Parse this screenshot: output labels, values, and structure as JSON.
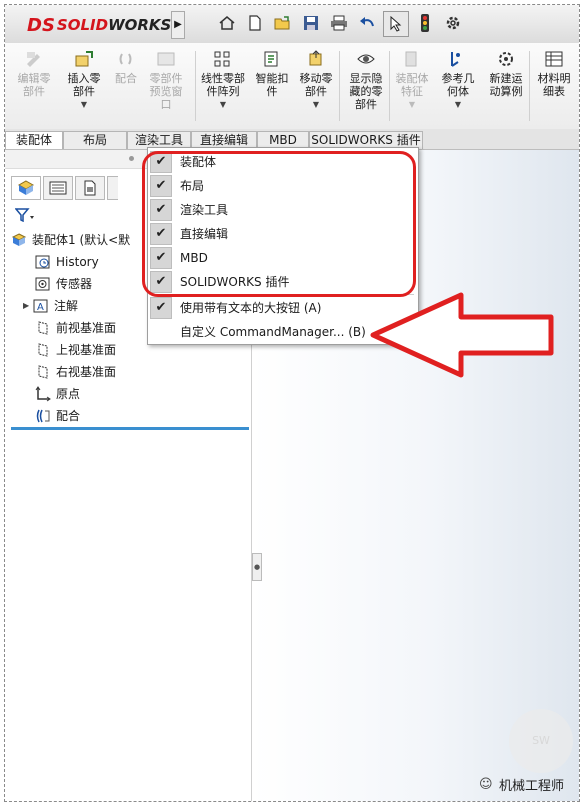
{
  "app": {
    "brand_ds": "DS",
    "brand_name": "SOLID",
    "brand_name2": "WORKS"
  },
  "quick_access": [
    {
      "name": "home-icon",
      "glyph": "⌂"
    },
    {
      "name": "new-file-icon",
      "glyph": "▢"
    },
    {
      "name": "open-icon",
      "glyph": "📂"
    },
    {
      "name": "save-icon",
      "glyph": "💾"
    },
    {
      "name": "print-icon",
      "glyph": "⎙"
    },
    {
      "name": "undo-icon",
      "glyph": "↶"
    },
    {
      "name": "select-icon",
      "glyph": "↖"
    },
    {
      "name": "rebuild-icon",
      "glyph": "🚦"
    },
    {
      "name": "options-icon",
      "glyph": "⚙"
    }
  ],
  "command_manager": [
    {
      "label": "编辑零\n部件",
      "disabled": true
    },
    {
      "label": "插入零\n部件",
      "disabled": false
    },
    {
      "label": "配合",
      "disabled": true
    },
    {
      "label": "零部件\n预览窗\n口",
      "disabled": true
    },
    {
      "label": "线性零部\n件阵列",
      "disabled": false
    },
    {
      "label": "智能扣\n件",
      "disabled": false
    },
    {
      "label": "移动零\n部件",
      "disabled": false
    },
    {
      "label": "显示隐\n藏的零\n部件",
      "disabled": false
    },
    {
      "label": "装配体\n特征",
      "disabled": true
    },
    {
      "label": "参考几\n何体",
      "disabled": false
    },
    {
      "label": "新建运\n动算例",
      "disabled": false
    },
    {
      "label": "材料明\n细表",
      "disabled": false
    }
  ],
  "tabs": [
    "装配体",
    "布局",
    "渲染工具",
    "直接编辑",
    "MBD",
    "SOLIDWORKS 插件"
  ],
  "tree": {
    "root": "装配体1  (默认<默",
    "items": [
      "History",
      "传感器",
      "注解",
      "前视基准面",
      "上视基准面",
      "右视基准面",
      "原点",
      "配合"
    ]
  },
  "context_menu": {
    "items": [
      {
        "label": "装配体",
        "checked": true
      },
      {
        "label": "布局",
        "checked": true
      },
      {
        "label": "渲染工具",
        "checked": true
      },
      {
        "label": "直接编辑",
        "checked": true
      },
      {
        "label": "MBD",
        "checked": true
      },
      {
        "label": "SOLIDWORKS 插件",
        "checked": true
      },
      {
        "label": "使用带有文本的大按钮 (A)",
        "checked": true
      },
      {
        "label": "自定义 CommandManager... (B)",
        "checked": false
      }
    ]
  },
  "watermark": {
    "badge": "SW",
    "text": "机械工程师"
  },
  "colors": {
    "brand_red": "#d4141c",
    "highlight_red": "#e02020",
    "tree_blue": "#3a8fd0"
  }
}
